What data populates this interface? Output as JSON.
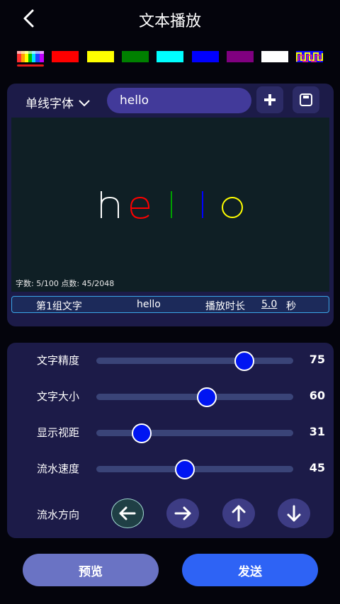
{
  "header": {
    "title": "文本播放",
    "back_icon": "chevron-left-icon"
  },
  "colors": [
    {
      "name": "rainbow",
      "hex": "multi",
      "selected": true
    },
    {
      "name": "red",
      "hex": "#ff0000"
    },
    {
      "name": "yellow",
      "hex": "#ffff00"
    },
    {
      "name": "green",
      "hex": "#008000"
    },
    {
      "name": "cyan",
      "hex": "#00ffff"
    },
    {
      "name": "blue",
      "hex": "#0000ff"
    },
    {
      "name": "purple",
      "hex": "#800080"
    },
    {
      "name": "white",
      "hex": "#ffffff"
    },
    {
      "name": "pattern",
      "hex": "multi"
    }
  ],
  "text_panel": {
    "font_label": "单线字体",
    "input_value": "hello",
    "add_icon": "plus-icon",
    "save_icon": "save-icon",
    "preview_text": "hello",
    "preview_letter_colors": [
      "#ffffff",
      "#ff0000",
      "#00a000",
      "#0000ff",
      "#ffff00"
    ],
    "stats": "字数: 5/100  点数: 45/2048"
  },
  "group": {
    "label": "第1组文字",
    "text": "hello",
    "duration_label": "播放时长",
    "duration_value": "5.0",
    "duration_unit": "秒"
  },
  "sliders": [
    {
      "label": "文字精度",
      "value": "75",
      "percent": 75
    },
    {
      "label": "文字大小",
      "value": "60",
      "percent": 56
    },
    {
      "label": "显示视距",
      "value": "31",
      "percent": 23
    },
    {
      "label": "流水速度",
      "value": "45",
      "percent": 45
    }
  ],
  "direction": {
    "label": "流水方向",
    "options": [
      "arrow-left-icon",
      "arrow-right-icon",
      "arrow-up-icon",
      "arrow-down-icon"
    ],
    "selected": "arrow-left-icon"
  },
  "actions": {
    "preview_label": "预览",
    "send_label": "发送"
  }
}
